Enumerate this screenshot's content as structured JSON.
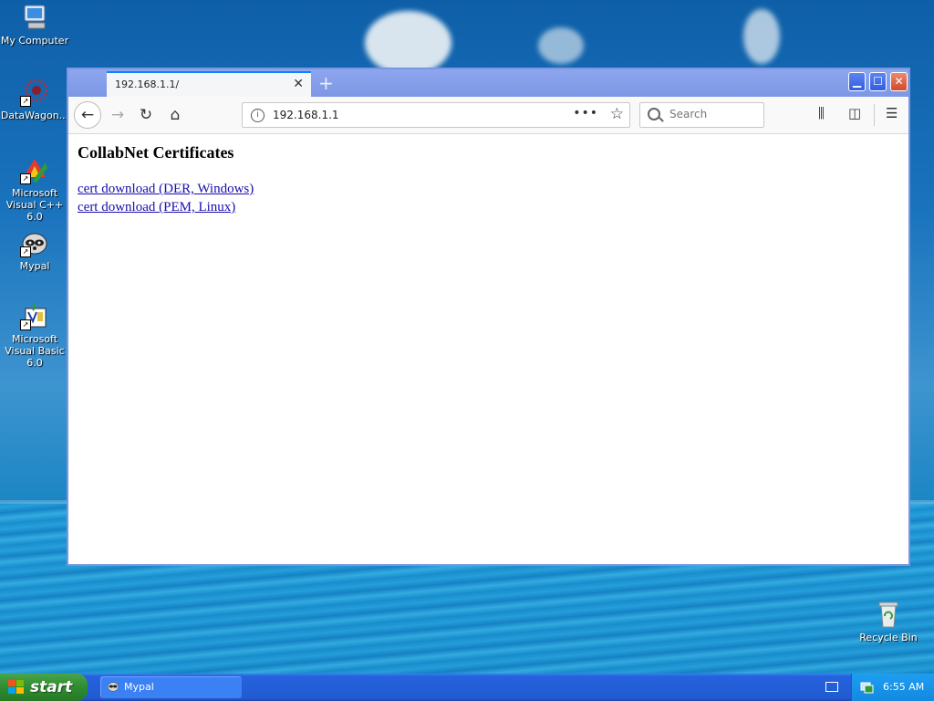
{
  "desktop": {
    "icons": [
      {
        "label": "My Computer"
      },
      {
        "label": "DataWagon..."
      },
      {
        "label": "Microsoft Visual C++ 6.0"
      },
      {
        "label": "Mypal"
      },
      {
        "label": "Microsoft Visual Basic 6.0"
      },
      {
        "label": "Recycle Bin"
      }
    ]
  },
  "browser": {
    "tab": {
      "title": "192.168.1.1/"
    },
    "urlbar": {
      "url": "192.168.1.1"
    },
    "search": {
      "placeholder": "Search"
    },
    "page": {
      "title": "CollabNet Certificates",
      "links": [
        {
          "label": "cert download (DER, Windows)"
        },
        {
          "label": "cert download (PEM, Linux)"
        }
      ]
    }
  },
  "taskbar": {
    "start_label": "start",
    "items": [
      {
        "label": "Mypal"
      }
    ],
    "clock": "6:55 AM"
  },
  "colors": {
    "link": "#1a0dab",
    "tab_accent": "#0a84ff",
    "start_green": "#2f8c2f",
    "taskbar_blue": "#225bd1"
  }
}
